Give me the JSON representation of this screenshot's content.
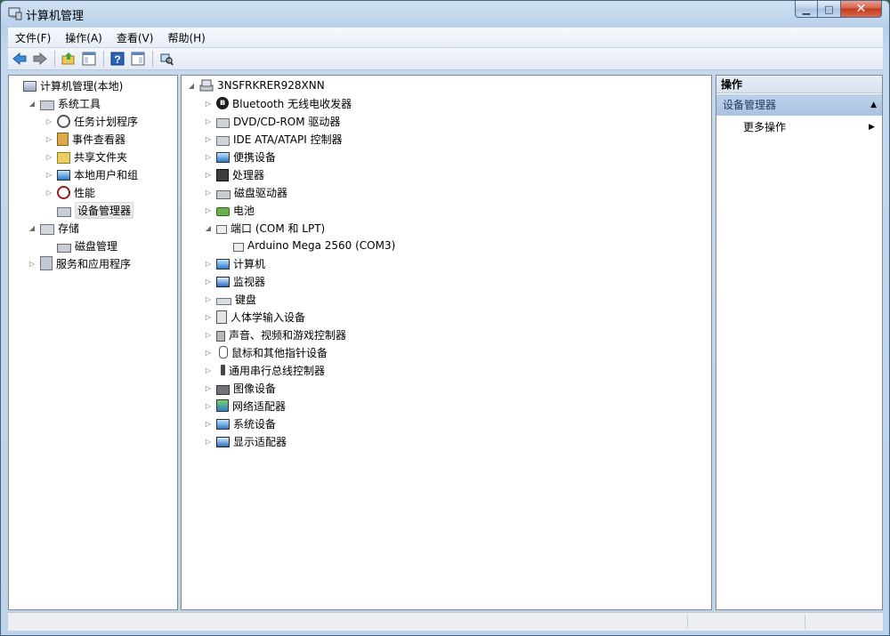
{
  "window": {
    "title": "计算机管理"
  },
  "menu": [
    "文件(F)",
    "操作(A)",
    "查看(V)",
    "帮助(H)"
  ],
  "toolbar": {
    "icons": [
      "back-icon",
      "forward-icon",
      "up-folder-icon",
      "show-hide-tree-icon",
      "help-icon",
      "show-action-pane-icon",
      "scan-hardware-icon"
    ]
  },
  "left_tree": [
    {
      "label": "计算机管理(本地)",
      "icon": "computer-management-icon",
      "level": 0,
      "expander": "none"
    },
    {
      "label": "系统工具",
      "icon": "tools-icon",
      "level": 1,
      "expander": "expanded"
    },
    {
      "label": "任务计划程序",
      "icon": "clock-icon",
      "level": 2,
      "expander": "collapsed"
    },
    {
      "label": "事件查看器",
      "icon": "event-viewer-icon",
      "level": 2,
      "expander": "collapsed"
    },
    {
      "label": "共享文件夹",
      "icon": "shared-folder-icon",
      "level": 2,
      "expander": "collapsed"
    },
    {
      "label": "本地用户和组",
      "icon": "users-icon",
      "level": 2,
      "expander": "collapsed"
    },
    {
      "label": "性能",
      "icon": "performance-icon",
      "level": 2,
      "expander": "collapsed"
    },
    {
      "label": "设备管理器",
      "icon": "device-manager-icon",
      "level": 2,
      "expander": "none",
      "selected": true
    },
    {
      "label": "存储",
      "icon": "storage-icon",
      "level": 1,
      "expander": "expanded"
    },
    {
      "label": "磁盘管理",
      "icon": "disk-management-icon",
      "level": 2,
      "expander": "none"
    },
    {
      "label": "服务和应用程序",
      "icon": "services-icon",
      "level": 1,
      "expander": "collapsed"
    }
  ],
  "device_tree": {
    "root": "3NSFRKRER928XNN",
    "items": [
      {
        "label": "Bluetooth 无线电收发器",
        "icon": "bluetooth-icon",
        "level": 1,
        "expander": "collapsed"
      },
      {
        "label": "DVD/CD-ROM 驱动器",
        "icon": "dvd-drive-icon",
        "level": 1,
        "expander": "collapsed"
      },
      {
        "label": "IDE ATA/ATAPI 控制器",
        "icon": "ide-controller-icon",
        "level": 1,
        "expander": "collapsed"
      },
      {
        "label": "便携设备",
        "icon": "portable-device-icon",
        "level": 1,
        "expander": "collapsed"
      },
      {
        "label": "处理器",
        "icon": "processor-icon",
        "level": 1,
        "expander": "collapsed"
      },
      {
        "label": "磁盘驱动器",
        "icon": "disk-drive-icon",
        "level": 1,
        "expander": "collapsed"
      },
      {
        "label": "电池",
        "icon": "battery-icon",
        "level": 1,
        "expander": "collapsed"
      },
      {
        "label": "端口 (COM 和 LPT)",
        "icon": "port-icon",
        "level": 1,
        "expander": "expanded"
      },
      {
        "label": "Arduino Mega 2560 (COM3)",
        "icon": "port-icon",
        "level": 2,
        "expander": "none"
      },
      {
        "label": "计算机",
        "icon": "computer-icon",
        "level": 1,
        "expander": "collapsed"
      },
      {
        "label": "监视器",
        "icon": "monitor-icon",
        "level": 1,
        "expander": "collapsed"
      },
      {
        "label": "键盘",
        "icon": "keyboard-icon",
        "level": 1,
        "expander": "collapsed"
      },
      {
        "label": "人体学输入设备",
        "icon": "hid-icon",
        "level": 1,
        "expander": "collapsed"
      },
      {
        "label": "声音、视频和游戏控制器",
        "icon": "sound-icon",
        "level": 1,
        "expander": "collapsed"
      },
      {
        "label": "鼠标和其他指针设备",
        "icon": "mouse-icon",
        "level": 1,
        "expander": "collapsed"
      },
      {
        "label": "通用串行总线控制器",
        "icon": "usb-icon",
        "level": 1,
        "expander": "collapsed"
      },
      {
        "label": "图像设备",
        "icon": "camera-icon",
        "level": 1,
        "expander": "collapsed"
      },
      {
        "label": "网络适配器",
        "icon": "network-adapter-icon",
        "level": 1,
        "expander": "collapsed"
      },
      {
        "label": "系统设备",
        "icon": "system-device-icon",
        "level": 1,
        "expander": "collapsed"
      },
      {
        "label": "显示适配器",
        "icon": "display-adapter-icon",
        "level": 1,
        "expander": "collapsed"
      }
    ]
  },
  "actions": {
    "header": "操作",
    "section": "设备管理器",
    "more": "更多操作"
  },
  "colors": {
    "selection_bg": "#e3e3e3",
    "action_section_bg": "#b3cbe6",
    "desktop": "#2d6b2a"
  }
}
